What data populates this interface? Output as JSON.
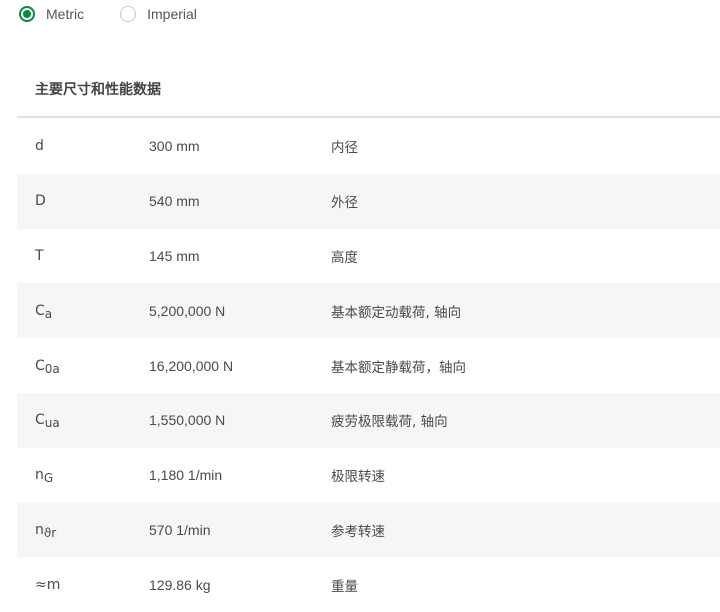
{
  "units": {
    "options": [
      {
        "label": "Metric",
        "selected": true
      },
      {
        "label": "Imperial",
        "selected": false
      }
    ],
    "accent": "#0a8a3f"
  },
  "section": {
    "title": "主要尺寸和性能数据"
  },
  "rows": [
    {
      "symbol": "d",
      "sub": "",
      "value": "300 mm",
      "desc": "内径"
    },
    {
      "symbol": "D",
      "sub": "",
      "value": "540 mm",
      "desc": "外径"
    },
    {
      "symbol": "T",
      "sub": "",
      "value": "145 mm",
      "desc": "高度"
    },
    {
      "symbol": "C",
      "sub": "a",
      "value": "5,200,000 N",
      "desc": "基本额定动载荷, 轴向"
    },
    {
      "symbol": "C",
      "sub": "0a",
      "value": "16,200,000 N",
      "desc": "基本额定静载荷，轴向"
    },
    {
      "symbol": "C",
      "sub": "ua",
      "value": "1,550,000 N",
      "desc": "疲劳极限载荷, 轴向"
    },
    {
      "symbol": "n",
      "sub": "G",
      "value": "1,180 1/min",
      "desc": "极限转速"
    },
    {
      "symbol": "n",
      "sub": "ϑr",
      "value": "570 1/min",
      "desc": "参考转速"
    },
    {
      "symbol": "≈m",
      "sub": "",
      "value": "129.86 kg",
      "desc": "重量"
    }
  ]
}
